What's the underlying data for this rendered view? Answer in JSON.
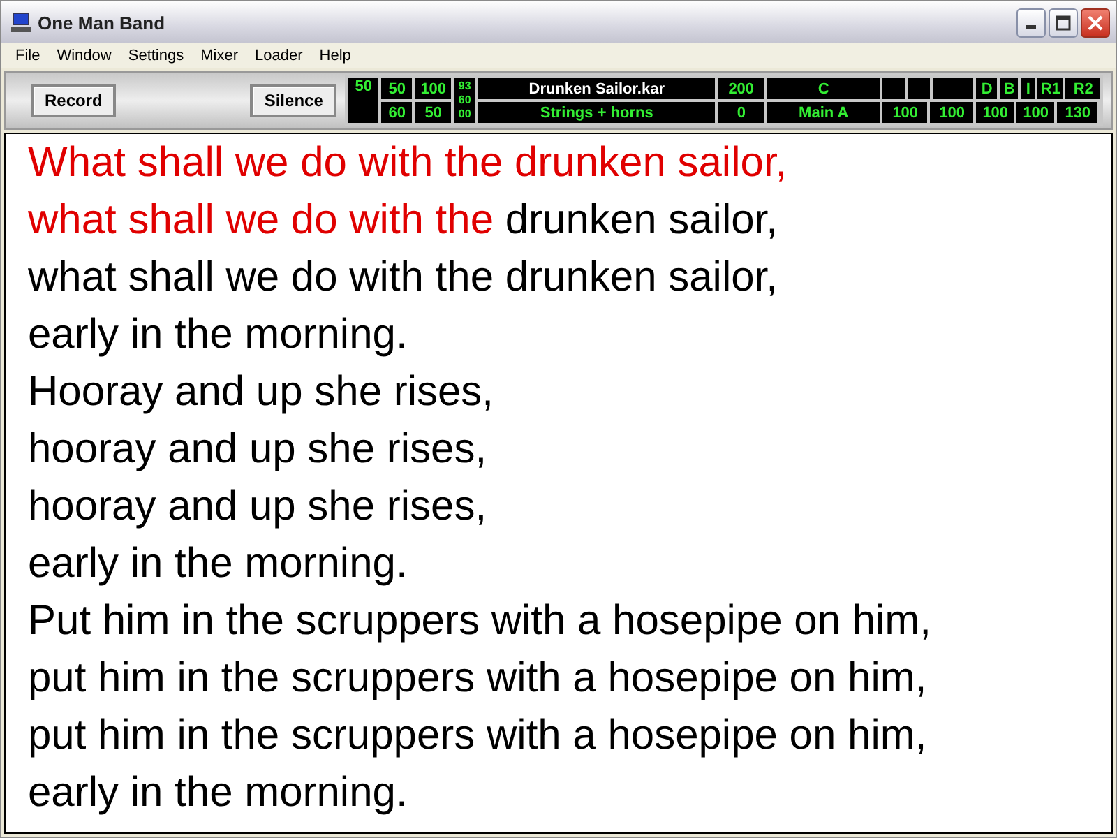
{
  "window": {
    "title": "One Man Band"
  },
  "menu": [
    "File",
    "Window",
    "Settings",
    "Mixer",
    "Loader",
    "Help"
  ],
  "toolbar": {
    "buttons": [
      "Record",
      "Silence"
    ]
  },
  "display": {
    "master": "50",
    "pairs": [
      [
        "50",
        "60"
      ],
      [
        "100",
        "50"
      ]
    ],
    "small_digits": [
      "93",
      "60",
      "00"
    ],
    "top_row": [
      {
        "kind": "text",
        "text": "Drunken Sailor.kar"
      },
      {
        "kind": "text",
        "text": "200"
      },
      {
        "kind": "text",
        "text": "C"
      },
      {
        "kind": "blank"
      },
      {
        "kind": "blank"
      },
      {
        "kind": "blank"
      },
      {
        "kind": "text",
        "text": "D"
      },
      {
        "kind": "text",
        "text": "B"
      },
      {
        "kind": "text",
        "text": "I"
      },
      {
        "kind": "text",
        "text": "R1"
      },
      {
        "kind": "text",
        "text": "R2"
      }
    ],
    "bottom_row": [
      {
        "kind": "text",
        "text": "Strings + horns"
      },
      {
        "kind": "text",
        "text": "0"
      },
      {
        "kind": "text",
        "text": "Main A"
      },
      {
        "kind": "text",
        "text": "100"
      },
      {
        "kind": "text",
        "text": "100"
      },
      {
        "kind": "text",
        "text": "100"
      },
      {
        "kind": "text",
        "text": "100"
      },
      {
        "kind": "text",
        "text": "130"
      }
    ]
  },
  "lyrics": [
    {
      "segments": [
        {
          "text": "What shall we do with the drunken sailor,",
          "sung": true
        }
      ]
    },
    {
      "segments": [
        {
          "text": "what shall we do with the",
          "sung": true
        },
        {
          "text": " drunken sailor,",
          "sung": false
        }
      ]
    },
    {
      "segments": [
        {
          "text": "what shall we do with the drunken sailor,",
          "sung": false
        }
      ]
    },
    {
      "segments": [
        {
          "text": "early in the morning.",
          "sung": false
        }
      ]
    },
    {
      "segments": [
        {
          "text": "Hooray and up she rises,",
          "sung": false
        }
      ]
    },
    {
      "segments": [
        {
          "text": "hooray and up she rises,",
          "sung": false
        }
      ]
    },
    {
      "segments": [
        {
          "text": "hooray and up she rises,",
          "sung": false
        }
      ]
    },
    {
      "segments": [
        {
          "text": "early in the morning.",
          "sung": false
        }
      ]
    },
    {
      "segments": [
        {
          "text": "Put him in the scruppers with a hosepipe on him,",
          "sung": false
        }
      ]
    },
    {
      "segments": [
        {
          "text": "put him in the scruppers with a hosepipe on him,",
          "sung": false
        }
      ]
    },
    {
      "segments": [
        {
          "text": "put him in the scruppers with a hosepipe on him,",
          "sung": false
        }
      ]
    },
    {
      "segments": [
        {
          "text": "early in the morning.",
          "sung": false
        }
      ]
    }
  ]
}
